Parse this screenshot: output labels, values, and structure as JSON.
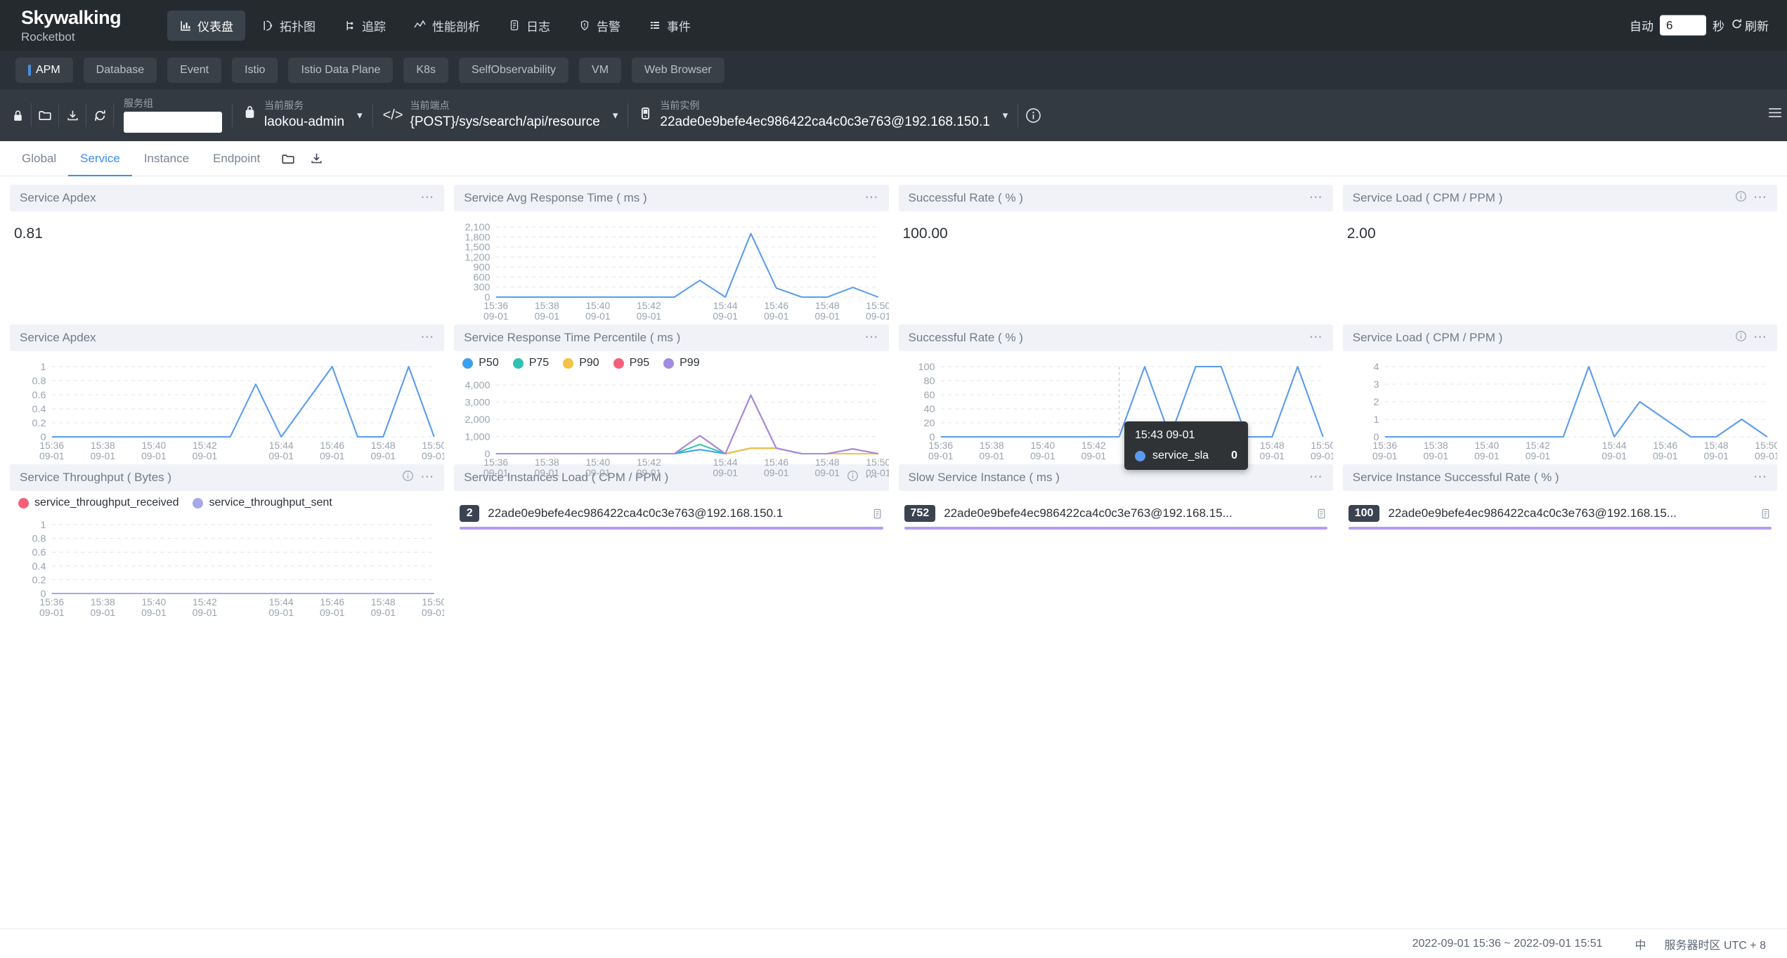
{
  "header": {
    "brand_main": "Skywalking",
    "brand_sub": "Rocketbot",
    "nav": [
      {
        "label": "仪表盘",
        "icon": "dashboard-icon",
        "active": true
      },
      {
        "label": "拓扑图",
        "icon": "topology-icon",
        "active": false
      },
      {
        "label": "追踪",
        "icon": "trace-icon",
        "active": false
      },
      {
        "label": "性能剖析",
        "icon": "profile-icon",
        "active": false
      },
      {
        "label": "日志",
        "icon": "log-icon",
        "active": false
      },
      {
        "label": "告警",
        "icon": "alarm-icon",
        "active": false
      },
      {
        "label": "事件",
        "icon": "event-icon",
        "active": false
      }
    ],
    "auto_label": "自动",
    "auto_value": "6",
    "second_label": "秒",
    "refresh_label": "刷新"
  },
  "layer_tabs": [
    {
      "label": "APM",
      "active": true
    },
    {
      "label": "Database",
      "active": false
    },
    {
      "label": "Event",
      "active": false
    },
    {
      "label": "Istio",
      "active": false
    },
    {
      "label": "Istio Data Plane",
      "active": false
    },
    {
      "label": "K8s",
      "active": false
    },
    {
      "label": "SelfObservability",
      "active": false
    },
    {
      "label": "VM",
      "active": false
    },
    {
      "label": "Web Browser",
      "active": false
    }
  ],
  "selector": {
    "icons": [
      "lock-icon",
      "folder-icon",
      "download-icon",
      "refresh-icon"
    ],
    "group_label": "服务组",
    "group_value": "",
    "service_label": "当前服务",
    "service_value": "laokou-admin",
    "endpoint_label": "当前端点",
    "endpoint_value": "{POST}/sys/search/api/resource",
    "instance_label": "当前实例",
    "instance_value": "22ade0e9befe4ec986422ca4c0c3e763@192.168.150.1"
  },
  "subtabs": [
    {
      "label": "Global",
      "active": false
    },
    {
      "label": "Service",
      "active": true
    },
    {
      "label": "Instance",
      "active": false
    },
    {
      "label": "Endpoint",
      "active": false
    }
  ],
  "panels": {
    "service_apdex_num": {
      "title": "Service Apdex",
      "value": "0.81"
    },
    "avg_response": {
      "title": "Service Avg Response Time ( ms )"
    },
    "successful_rate_num": {
      "title": "Successful Rate ( % )",
      "value": "100.00"
    },
    "service_load_num": {
      "title": "Service Load ( CPM / PPM )",
      "value": "2.00"
    },
    "service_apdex_chart": {
      "title": "Service Apdex"
    },
    "percentile": {
      "title": "Service Response Time Percentile ( ms )"
    },
    "successful_rate_chart": {
      "title": "Successful Rate ( % )"
    },
    "service_load_chart": {
      "title": "Service Load ( CPM / PPM )"
    },
    "throughput": {
      "title": "Service Throughput ( Bytes )"
    },
    "instances_load": {
      "title": "Service Instances Load ( CPM / PPM )",
      "rows": [
        {
          "badge": "2",
          "name": "22ade0e9befe4ec986422ca4c0c3e763@192.168.150.1",
          "bar_pct": 100
        }
      ]
    },
    "slow_instance": {
      "title": "Slow Service Instance ( ms )",
      "rows": [
        {
          "badge": "752",
          "name": "22ade0e9befe4ec986422ca4c0c3e763@192.168.15...",
          "bar_pct": 100
        }
      ]
    },
    "instance_success": {
      "title": "Service Instance Successful Rate ( % )",
      "rows": [
        {
          "badge": "100",
          "name": "22ade0e9befe4ec986422ca4c0c3e763@192.168.15...",
          "bar_pct": 100
        }
      ]
    }
  },
  "tooltip": {
    "time": "15:43 09-01",
    "series": "service_sla",
    "value": "0",
    "color": "#5a9bf0"
  },
  "footer": {
    "time_range": "2022-09-01 15:36 ~ 2022-09-01 15:51",
    "lang": "中",
    "timezone": "服务器时区 UTC + 8"
  },
  "colors": {
    "accent": "#3b8ef3",
    "line": "#5a9bf0",
    "p50": "#3ba0ef",
    "p75": "#2fc2b3",
    "p90": "#f5c242",
    "p95": "#f4607a",
    "p99": "#a28ce0",
    "received": "#f4607a",
    "sent": "#a6a9e8",
    "bar": "#b79df0"
  },
  "chart_data": [
    {
      "type": "line",
      "name": "Service Avg Response Time ( ms )",
      "title": "Service Avg Response Time ( ms )",
      "xlabel": "",
      "ylabel": "ms",
      "ylim": [
        0,
        2100
      ],
      "yticks": [
        0,
        300,
        600,
        900,
        1200,
        1500,
        1800,
        2100
      ],
      "ytick_labels": [
        "0",
        "300",
        "600",
        "900",
        "1,200",
        "1,500",
        "1,800",
        "2,100"
      ],
      "x": [
        "15:36",
        "15:37",
        "15:38",
        "15:39",
        "15:40",
        "15:41",
        "15:42",
        "15:43",
        "15:44",
        "15:45",
        "15:46",
        "15:47",
        "15:48",
        "15:49",
        "15:50",
        "15:51"
      ],
      "xtick_labels": [
        "15:36\n09-01",
        "15:38\n09-01",
        "15:40\n09-01",
        "15:42\n09-01",
        "15:44\n09-01",
        "15:46\n09-01",
        "15:48\n09-01",
        "15:50\n09-01"
      ],
      "values": [
        0,
        0,
        0,
        0,
        0,
        0,
        0,
        0,
        500,
        0,
        1900,
        270,
        0,
        0,
        290,
        0
      ],
      "grid": true,
      "legend": false
    },
    {
      "type": "line",
      "name": "Service Apdex",
      "title": "Service Apdex",
      "ylim": [
        0,
        1
      ],
      "yticks": [
        0,
        0.2,
        0.4,
        0.6,
        0.8,
        1
      ],
      "ytick_labels": [
        "0",
        "0.2",
        "0.4",
        "0.6",
        "0.8",
        "1"
      ],
      "x": [
        "15:36",
        "15:37",
        "15:38",
        "15:39",
        "15:40",
        "15:41",
        "15:42",
        "15:43",
        "15:44",
        "15:45",
        "15:46",
        "15:47",
        "15:48",
        "15:49",
        "15:50",
        "15:51"
      ],
      "xtick_labels": [
        "15:36\n09-01",
        "15:38\n09-01",
        "15:40\n09-01",
        "15:42\n09-01",
        "15:44\n09-01",
        "15:46\n09-01",
        "15:48\n09-01",
        "15:50\n09-01"
      ],
      "values": [
        0,
        0,
        0,
        0,
        0,
        0,
        0,
        0,
        0.75,
        0,
        0.5,
        1,
        0,
        0,
        1,
        0
      ],
      "grid": true,
      "legend": false
    },
    {
      "type": "line",
      "name": "Service Response Time Percentile ( ms )",
      "title": "Service Response Time Percentile ( ms )",
      "ylim": [
        0,
        4000
      ],
      "yticks": [
        0,
        1000,
        2000,
        3000,
        4000
      ],
      "ytick_labels": [
        "0",
        "1,000",
        "2,000",
        "3,000",
        "4,000"
      ],
      "x": [
        "15:36",
        "15:37",
        "15:38",
        "15:39",
        "15:40",
        "15:41",
        "15:42",
        "15:43",
        "15:44",
        "15:45",
        "15:46",
        "15:47",
        "15:48",
        "15:49",
        "15:50",
        "15:51"
      ],
      "xtick_labels": [
        "15:36\n09-01",
        "15:38\n09-01",
        "15:40\n09-01",
        "15:42\n09-01",
        "15:44\n09-01",
        "15:46\n09-01",
        "15:48\n09-01",
        "15:50\n09-01"
      ],
      "legend": true,
      "legend_position": "top-left",
      "series": [
        {
          "name": "P50",
          "color": "#3ba0ef",
          "values": [
            0,
            0,
            0,
            0,
            0,
            0,
            0,
            0,
            240,
            0,
            320,
            320,
            0,
            0,
            0,
            0
          ]
        },
        {
          "name": "P75",
          "color": "#2fc2b3",
          "values": [
            0,
            0,
            0,
            0,
            0,
            0,
            0,
            0,
            540,
            0,
            320,
            320,
            0,
            0,
            0,
            0
          ]
        },
        {
          "name": "P90",
          "color": "#f5c242",
          "values": [
            0,
            0,
            0,
            0,
            0,
            0,
            0,
            0,
            1050,
            0,
            320,
            320,
            0,
            0,
            0,
            0
          ]
        },
        {
          "name": "P95",
          "color": "#f4607a",
          "values": [
            0,
            0,
            0,
            0,
            0,
            0,
            0,
            0,
            1050,
            0,
            3400,
            320,
            0,
            0,
            280,
            0
          ]
        },
        {
          "name": "P99",
          "color": "#a28ce0",
          "values": [
            0,
            0,
            0,
            0,
            0,
            0,
            0,
            0,
            1050,
            0,
            3400,
            320,
            0,
            0,
            280,
            0
          ]
        }
      ],
      "grid": true
    },
    {
      "type": "line",
      "name": "Successful Rate ( % )",
      "title": "Successful Rate ( % )",
      "ylim": [
        0,
        100
      ],
      "yticks": [
        0,
        20,
        40,
        60,
        80,
        100
      ],
      "ytick_labels": [
        "0",
        "20",
        "40",
        "60",
        "80",
        "100"
      ],
      "x": [
        "15:36",
        "15:37",
        "15:38",
        "15:39",
        "15:40",
        "15:41",
        "15:42",
        "15:43",
        "15:44",
        "15:45",
        "15:46",
        "15:47",
        "15:48",
        "15:49",
        "15:50",
        "15:51"
      ],
      "xtick_labels": [
        "15:36\n09-01",
        "15:38\n09-01",
        "15:40\n09-01",
        "15:42\n09-01",
        "15:44\n09-01",
        "15:46\n09-01",
        "15:48\n09-01",
        "15:50\n09-01"
      ],
      "values": [
        0,
        0,
        0,
        0,
        0,
        0,
        0,
        0,
        100,
        0,
        100,
        100,
        0,
        0,
        100,
        0
      ],
      "series_name": "service_sla",
      "grid": true,
      "legend": false
    },
    {
      "type": "line",
      "name": "Service Load ( CPM / PPM )",
      "title": "Service Load ( CPM / PPM )",
      "ylim": [
        0,
        4
      ],
      "yticks": [
        0,
        1,
        2,
        3,
        4
      ],
      "ytick_labels": [
        "0",
        "1",
        "2",
        "3",
        "4"
      ],
      "x": [
        "15:36",
        "15:37",
        "15:38",
        "15:39",
        "15:40",
        "15:41",
        "15:42",
        "15:43",
        "15:44",
        "15:45",
        "15:46",
        "15:47",
        "15:48",
        "15:49",
        "15:50",
        "15:51"
      ],
      "xtick_labels": [
        "15:36\n09-01",
        "15:38\n09-01",
        "15:40\n09-01",
        "15:42\n09-01",
        "15:44\n09-01",
        "15:46\n09-01",
        "15:48\n09-01",
        "15:50\n09-01"
      ],
      "values": [
        0,
        0,
        0,
        0,
        0,
        0,
        0,
        0,
        4,
        0,
        2,
        1,
        0,
        0,
        1,
        0
      ],
      "grid": true,
      "legend": false
    },
    {
      "type": "line",
      "name": "Service Throughput ( Bytes )",
      "title": "Service Throughput ( Bytes )",
      "ylim": [
        0,
        1
      ],
      "yticks": [
        0,
        0.2,
        0.4,
        0.6,
        0.8,
        1
      ],
      "ytick_labels": [
        "0",
        "0.2",
        "0.4",
        "0.6",
        "0.8",
        "1"
      ],
      "x": [
        "15:36",
        "15:37",
        "15:38",
        "15:39",
        "15:40",
        "15:41",
        "15:42",
        "15:43",
        "15:44",
        "15:45",
        "15:46",
        "15:47",
        "15:48",
        "15:49",
        "15:50",
        "15:51"
      ],
      "xtick_labels": [
        "15:36\n09-01",
        "15:38\n09-01",
        "15:40\n09-01",
        "15:42\n09-01",
        "15:44\n09-01",
        "15:46\n09-01",
        "15:48\n09-01",
        "15:50\n09-01"
      ],
      "legend": true,
      "legend_position": "top-left",
      "series": [
        {
          "name": "service_throughput_received",
          "color": "#f4607a",
          "values": [
            0,
            0,
            0,
            0,
            0,
            0,
            0,
            0,
            0,
            0,
            0,
            0,
            0,
            0,
            0,
            0
          ]
        },
        {
          "name": "service_throughput_sent",
          "color": "#a6a9e8",
          "values": [
            0,
            0,
            0,
            0,
            0,
            0,
            0,
            0,
            0,
            0,
            0,
            0,
            0,
            0,
            0,
            0
          ]
        }
      ],
      "grid": true
    }
  ]
}
